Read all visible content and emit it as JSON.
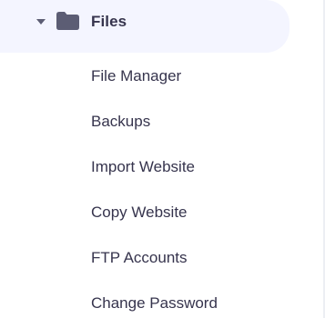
{
  "section": {
    "title": "Files",
    "expanded_icon": "chevron-down-icon",
    "icon": "folder-icon"
  },
  "submenu": {
    "items": [
      {
        "label": "File Manager"
      },
      {
        "label": "Backups"
      },
      {
        "label": "Import Website"
      },
      {
        "label": "Copy Website"
      },
      {
        "label": "FTP Accounts"
      },
      {
        "label": "Change Password"
      }
    ]
  },
  "colors": {
    "header_bg": "#f4f5ff",
    "text": "#36344d",
    "icon": "#5c5d74"
  }
}
